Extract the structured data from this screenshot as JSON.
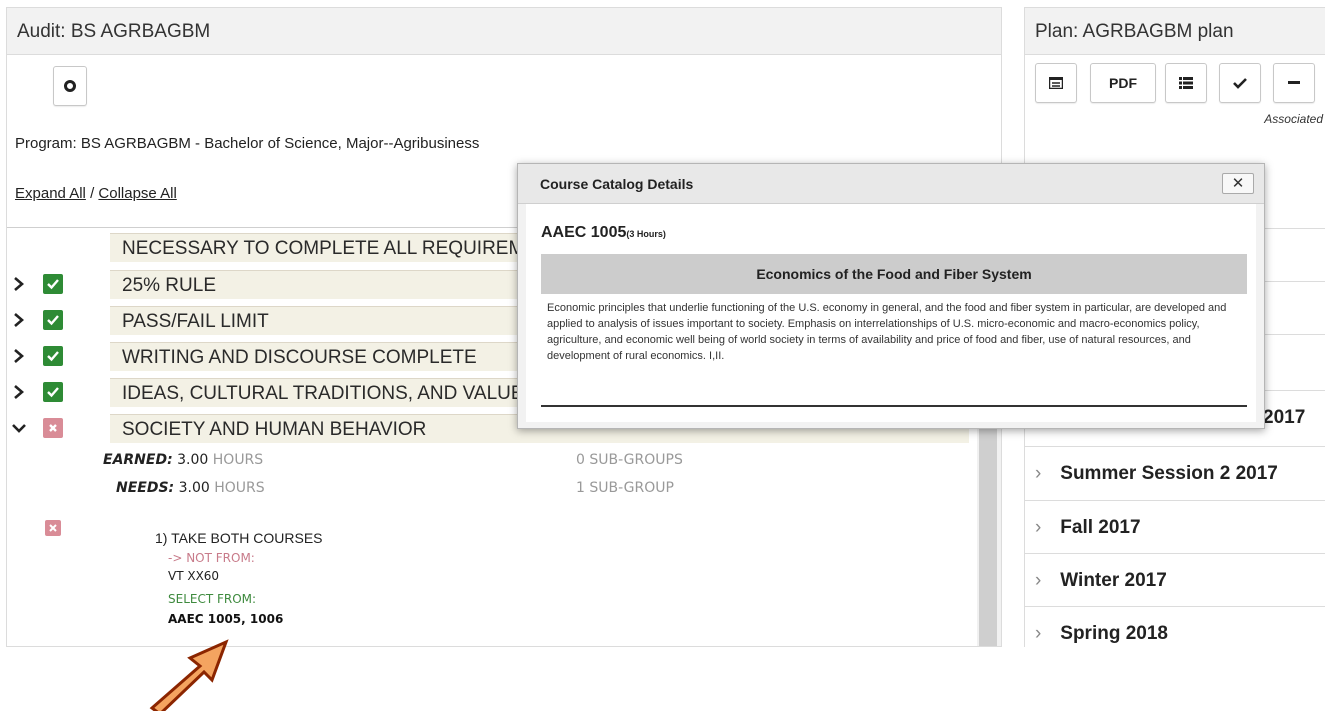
{
  "audit": {
    "title": "Audit: BS AGRBAGBM",
    "program": "Program: BS AGRBAGBM - Bachelor of Science, Major--Agribusiness",
    "expand_all": "Expand All",
    "separator": "/",
    "collapse_all": "Collapse All",
    "requirements": [
      {
        "label": "NECESSARY TO COMPLETE ALL REQUIREMENTS",
        "status": "none",
        "expanded": false
      },
      {
        "label": "25% RULE",
        "status": "complete",
        "expanded": false
      },
      {
        "label": "PASS/FAIL LIMIT",
        "status": "complete",
        "expanded": false
      },
      {
        "label": "WRITING AND DISCOURSE COMPLETE",
        "status": "complete",
        "expanded": false
      },
      {
        "label": "IDEAS, CULTURAL TRADITIONS, AND VALUES",
        "status": "complete",
        "expanded": false
      },
      {
        "label": "SOCIETY AND HUMAN BEHAVIOR",
        "status": "incomplete",
        "expanded": true
      }
    ],
    "earned_label": "EARNED:",
    "earned_value": "3.00",
    "earned_unit": "HOURS",
    "earned_subgroups": "0 SUB-GROUPS",
    "needs_label": "NEEDS:",
    "needs_value": "3.00",
    "needs_unit": "HOURS",
    "needs_subgroups": "1 SUB-GROUP",
    "subreq_title": "1)  TAKE BOTH COURSES",
    "not_from_label": "-> NOT FROM:",
    "not_from_courses": "VT XX60",
    "select_from_label": "SELECT FROM:",
    "select_from_courses": "AAEC 1005, 1006"
  },
  "plan": {
    "title": "Plan: AGRBAGBM plan",
    "pdf_label": "PDF",
    "associated_text": "Associated",
    "terms": [
      {
        "label": "2017",
        "partial": true
      },
      {
        "label": "Summer Session 2 2017"
      },
      {
        "label": "Fall 2017"
      },
      {
        "label": "Winter 2017"
      },
      {
        "label": "Spring 2018"
      }
    ]
  },
  "popup": {
    "title": "Course Catalog Details",
    "close_label": "✕",
    "course_code": "AAEC 1005",
    "course_hours": "(3 Hours)",
    "course_title": "Economics of the Food and Fiber System",
    "course_description": "Economic principles that underlie functioning of the U.S. economy in general, and the food and fiber system in particular, are developed and applied to analysis of issues important to society. Emphasis on interrelationships of U.S. micro-economic and macro-economics policy, agriculture, and economic well being of world society in terms of availability and price of food and fiber, use of natural resources, and development of rural economics. I,II."
  },
  "colors": {
    "complete": "#2e8b35",
    "incomplete": "#d98c97",
    "row_bg": "#f3f1e5",
    "arrow_fill": "#f4a460",
    "arrow_stroke": "#8b2500",
    "not_from": "#c87b8a",
    "select_from": "#3e8a3e"
  }
}
